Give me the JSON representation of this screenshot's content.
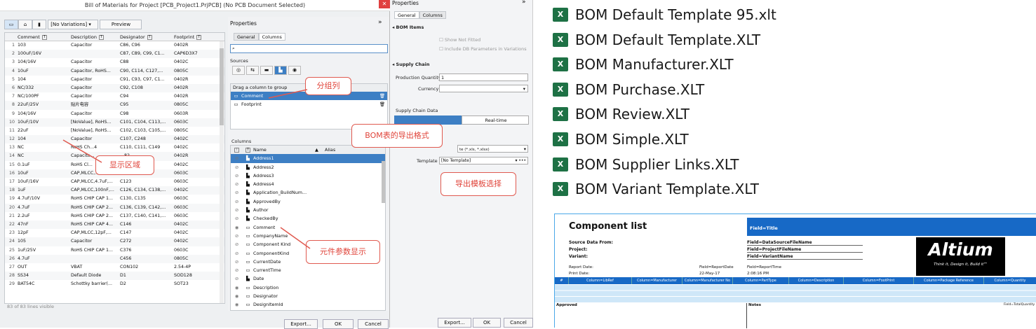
{
  "window": {
    "title": "Bill of Materials for Project [PCB_Project1.PrjPCB] (No PCB Document Selected)"
  },
  "toolbar": {
    "variations": "[No Variations]",
    "preview": "Preview"
  },
  "grid": {
    "headers": [
      "Comment",
      "Description",
      "Designator",
      "Footprint"
    ],
    "rows": [
      [
        "1",
        "103",
        "Capacitor",
        "C86, C96",
        "0402R"
      ],
      [
        "2",
        "100uF/16V",
        "",
        "C87, C89, C99, C1...",
        "CAP6D3X7"
      ],
      [
        "3",
        "104/16V",
        "Capacitor",
        "C88",
        "0402C"
      ],
      [
        "4",
        "10uF",
        "Capacitor, RoHS...",
        "C90, C114, C127,...",
        "0805C"
      ],
      [
        "5",
        "104",
        "Capacitor",
        "C91, C93, C97, C1...",
        "0402R"
      ],
      [
        "6",
        "NC/332",
        "Capacitor",
        "C92, C108",
        "0402R"
      ],
      [
        "7",
        "NC/100PF",
        "Capacitor",
        "C94",
        "0402R"
      ],
      [
        "8",
        "22uF/25V",
        "贴片电容",
        "C95",
        "0805C"
      ],
      [
        "9",
        "104/16V",
        "Capacitor",
        "C98",
        "0603R"
      ],
      [
        "10",
        "10uF/10V",
        "[NoValue], RoHS...",
        "C101, C104, C113,...",
        "0603C"
      ],
      [
        "11",
        "22uF",
        "[NoValue], RoHS...",
        "C102, C103, C105,...",
        "0805C"
      ],
      [
        "12",
        "104",
        "Capacitor",
        "C107, C248",
        "0402C"
      ],
      [
        "13",
        "NC",
        "RoHS Ch...4",
        "C110, C111, C149",
        "0402C"
      ],
      [
        "14",
        "NC",
        "Capacito...",
        "...82,...",
        "0402R"
      ],
      [
        "15",
        "0.1uF",
        "RoHS Cl...",
        "...19,...",
        "0402C"
      ],
      [
        "16",
        "10uF",
        "CAP,MLCC,...",
        "",
        "0603C"
      ],
      [
        "17",
        "10uF/16V",
        "CAP,MLCC,4.7uF,...",
        "C123",
        "0603C"
      ],
      [
        "18",
        "1uF",
        "CAP,MLCC,100nF,...",
        "C126, C134, C138,...",
        "0402C"
      ],
      [
        "19",
        "4.7uF/10V",
        "RoHS CHIP CAP 1...",
        "C130, C135",
        "0603C"
      ],
      [
        "20",
        "4.7uF",
        "RoHS CHIP CAP 2...",
        "C136, C139, C142,...",
        "0603C"
      ],
      [
        "21",
        "2.2uF",
        "RoHS CHIP CAP 2...",
        "C137, C140, C141,...",
        "0603C"
      ],
      [
        "22",
        "47nF",
        "RoHS CHIP CAP 4...",
        "C146",
        "0402C"
      ],
      [
        "23",
        "12pF",
        "CAP,MLCC,12pF,...",
        "C147",
        "0402C"
      ],
      [
        "24",
        "105",
        "Capacitor",
        "C272",
        "0402C"
      ],
      [
        "25",
        "1uF/25V",
        "RoHS CHIP CAP 1...",
        "C376",
        "0603C"
      ],
      [
        "26",
        "4.7uF",
        "",
        "C456",
        "0805C"
      ],
      [
        "27",
        "OUT",
        "VBAT",
        "CON102",
        "2.54-4P"
      ],
      [
        "28",
        "SS34",
        "Default Diode",
        "D1",
        "SOD128"
      ],
      [
        "29",
        "BAT54C",
        "Schottky barrier(...",
        "D2",
        "SOT23"
      ]
    ],
    "status": "83 of 83 lines visible"
  },
  "buttons": {
    "export": "Export...",
    "ok": "OK",
    "cancel": "Cancel"
  },
  "props": {
    "title": "Properties",
    "tab_general": "General",
    "tab_columns": "Columns",
    "sources": "Sources",
    "group_hint": "Drag a column to group",
    "group_items": [
      "Comment",
      "Footprint"
    ],
    "columns_title": "Columns",
    "col_name": "Name",
    "col_alias": "Alias",
    "columns": [
      "Address1",
      "Address2",
      "Address3",
      "Address4",
      "Application_BuildNum...",
      "ApprovedBy",
      "Author",
      "CheckedBy",
      "Comment",
      "CompanyName",
      "Component Kind",
      "ComponentKind",
      "CurrentDate",
      "CurrentTime",
      "Date",
      "Description",
      "Designator",
      "DesignItemId"
    ]
  },
  "props2": {
    "title": "Properties",
    "tab_general": "General",
    "tab_columns": "Columns",
    "bom_items": "BOM Items",
    "show_not_fitted": "Show Not Fitted",
    "include_db": "Include DB Parameters in Variations",
    "supply_chain": "Supply Chain",
    "prod_qty_label": "Production Quantity",
    "prod_qty": "1",
    "currency_label": "Currency",
    "supply_data": "Supply Chain Data",
    "realtime": "Real-time",
    "template_label": "Template",
    "template_value": "[No Template]",
    "file_value": "te (*.xls, *.xlsx)"
  },
  "callouts": {
    "group": "分组列",
    "display": "显示区域",
    "export_fmt": "BOM表的导出格式",
    "template": "导出模板选择",
    "params": "元件参数显示"
  },
  "templates": [
    "BOM Default Template 95.xlt",
    "BOM Default Template.XLT",
    "BOM Manufacturer.XLT",
    "BOM Purchase.XLT",
    "BOM Review.XLT",
    "BOM Simple.XLT",
    "BOM Supplier Links.XLT",
    "BOM Variant Template.XLT"
  ],
  "sheet": {
    "title": "Component list",
    "field_title": "Field=Title",
    "src_label": "Source Data From:",
    "proj_label": "Project:",
    "variant_label": "Variant:",
    "f_src": "Field=DataSourceFileName",
    "f_proj": "Field=ProjectFileName",
    "f_var": "Field=VariantName",
    "report_date": "Report Date:",
    "print_date": "Print Date:",
    "f_rdate": "Field=ReportDate",
    "v_rdate": "22-May-17",
    "f_rtime": "Field=ReportTime",
    "v_rtime": "2:08:16 PM",
    "brand": "Altium",
    "tagline": "Think it, Design it, Build it™",
    "cols": [
      "#",
      "Column=LibRef",
      "Column=Manufacturer",
      "Column=Manufacturer No",
      "Column=PartType",
      "Column=Description",
      "Column=FootPrint",
      "Column=Package Reference",
      "Column=Quantity"
    ],
    "approved": "Approved",
    "notes": "Notes",
    "total": "Field=TotalQuantity"
  }
}
